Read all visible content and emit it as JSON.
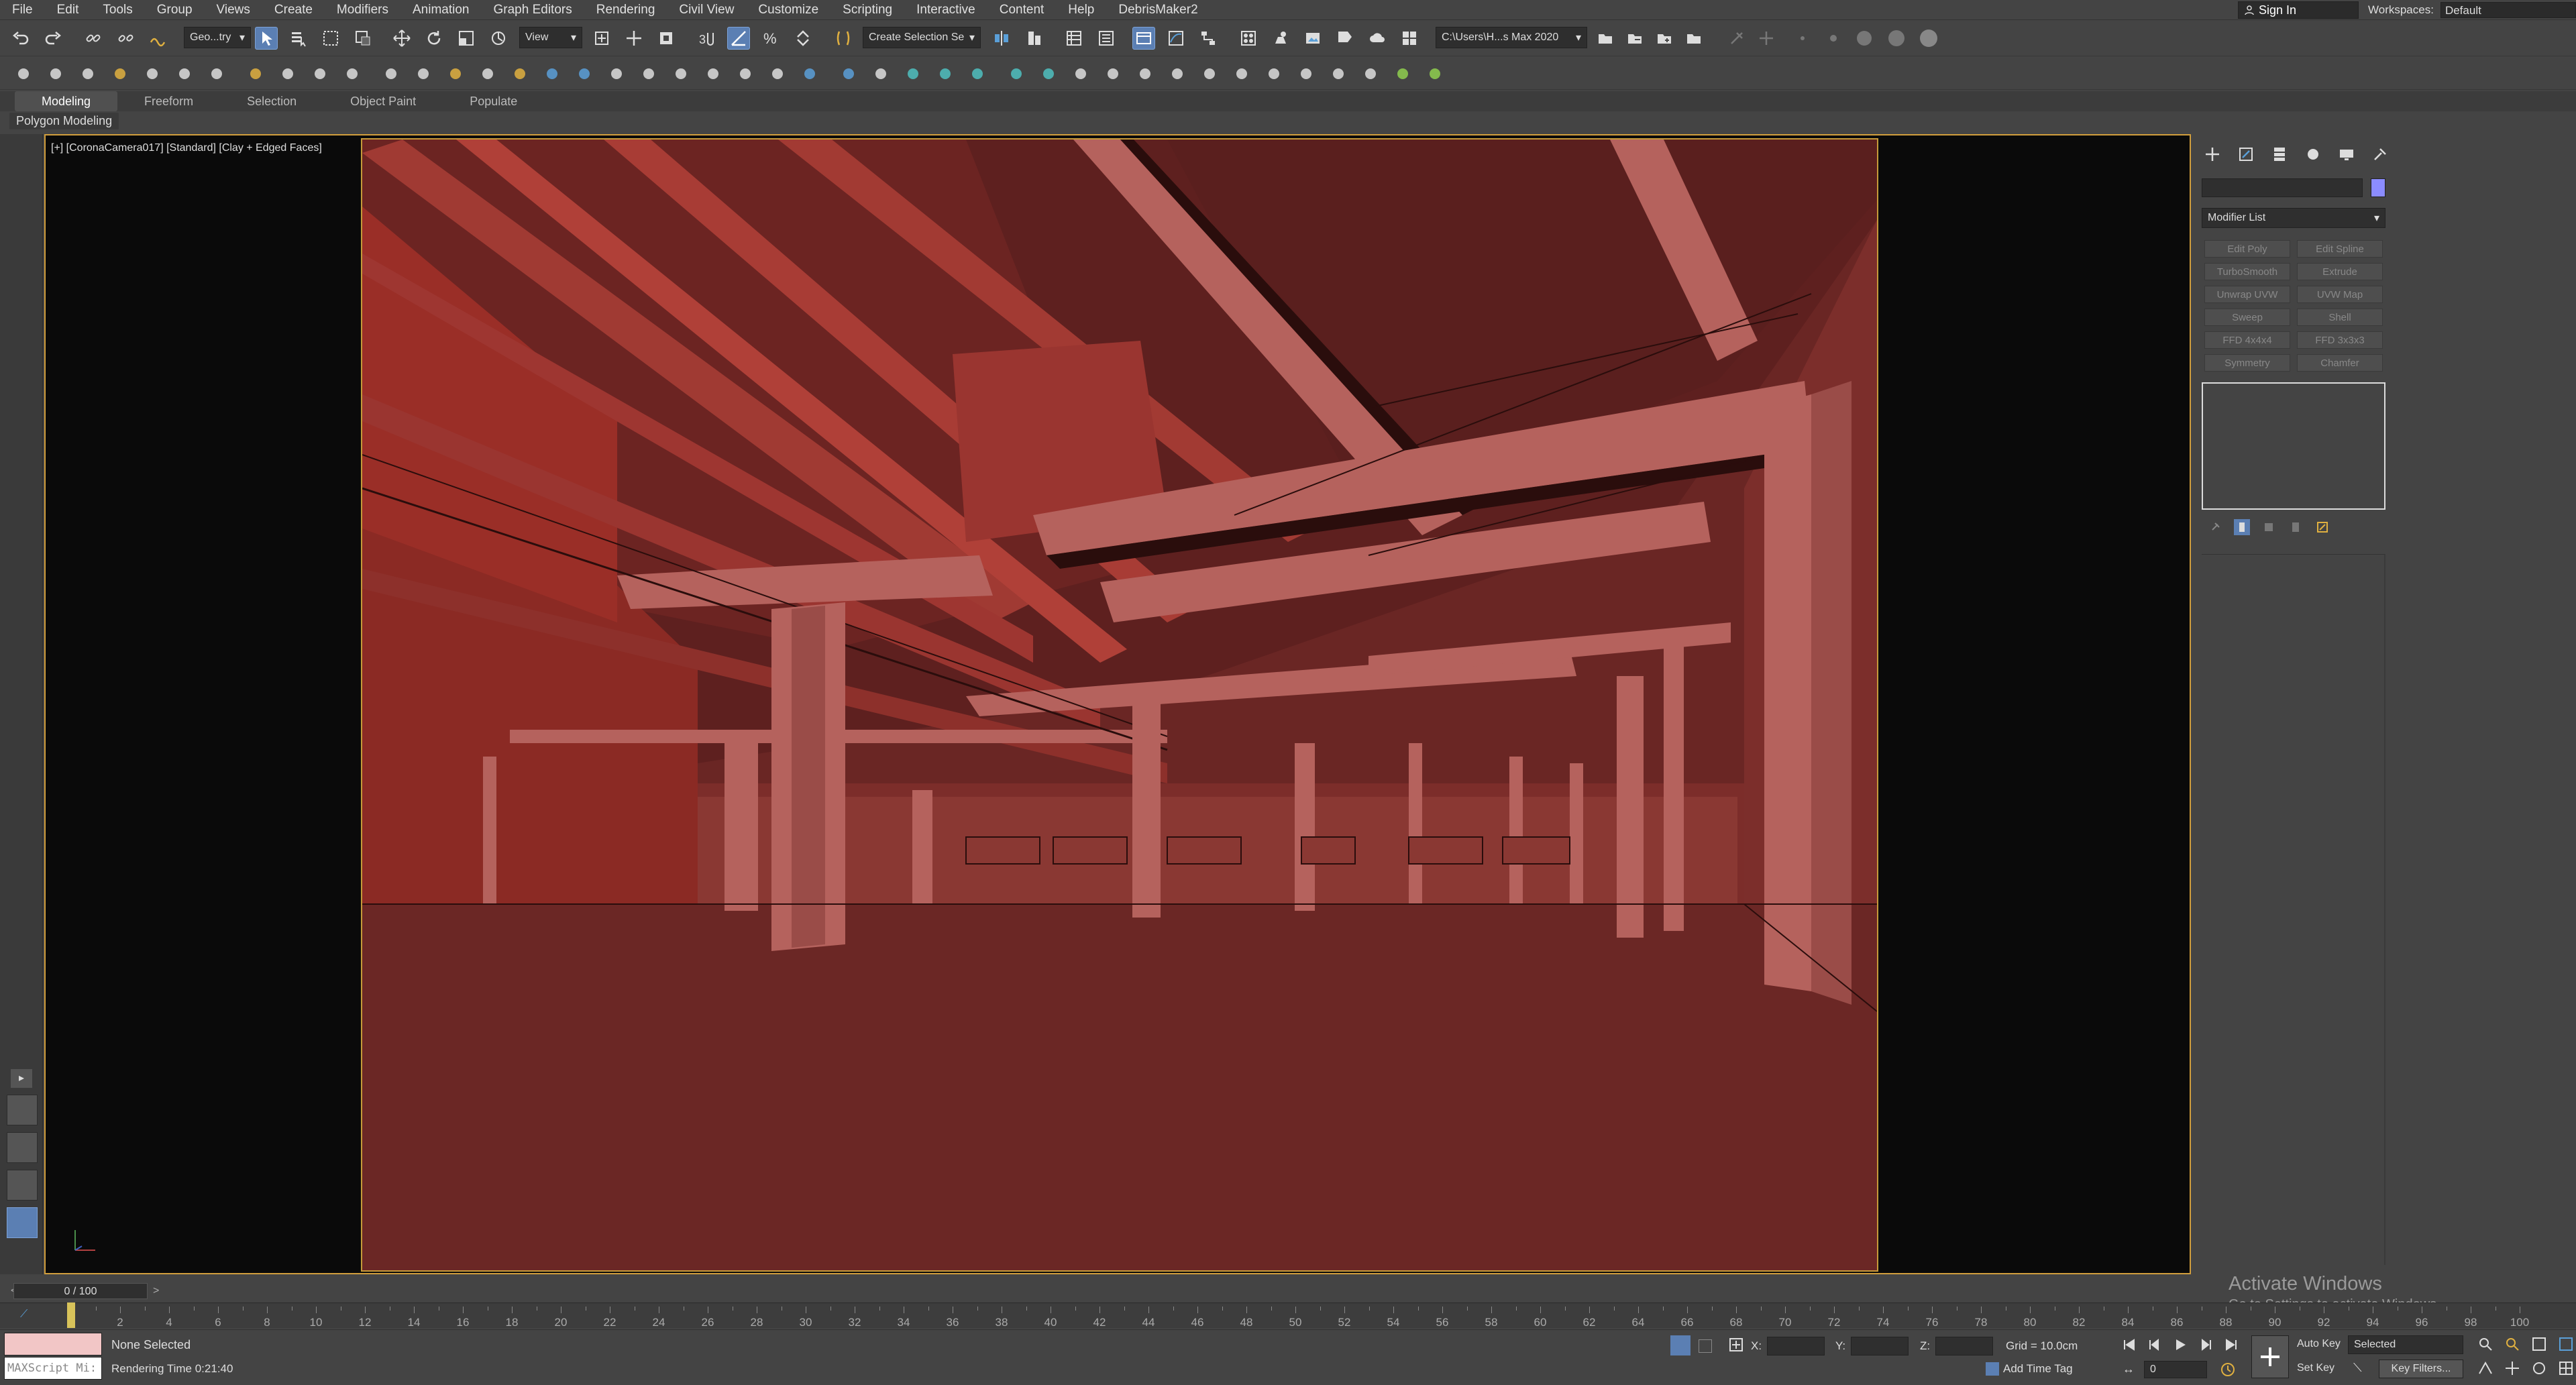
{
  "menubar": {
    "items": [
      "File",
      "Edit",
      "Tools",
      "Group",
      "Views",
      "Create",
      "Modifiers",
      "Animation",
      "Graph Editors",
      "Rendering",
      "Civil View",
      "Customize",
      "Scripting",
      "Interactive",
      "Content",
      "Help",
      "DebrisMaker2"
    ],
    "signin": "Sign In",
    "workspace_label": "Workspaces:",
    "workspace_value": "Default"
  },
  "toolbar": {
    "selection_filter": "Geo...try",
    "ref_coord": "View",
    "named_selection": "Create Selection Se",
    "project_path": "C:\\Users\\H...s Max 2020"
  },
  "ribbon": {
    "tabs": [
      "Modeling",
      "Freeform",
      "Selection",
      "Object Paint",
      "Populate"
    ],
    "active": "Modeling",
    "panel_label": "Polygon Modeling"
  },
  "viewport": {
    "label": "[+] [CoronaCamera017] [Standard] [Clay + Edged Faces]",
    "colors": {
      "scene_bg": "#6a2624",
      "beam": "#b5625d",
      "dark_edge": "#2a0d0c",
      "floor": "#6b2725"
    }
  },
  "command_panel": {
    "modifier_list": "Modifier List",
    "modifiers": [
      "Edit Poly",
      "Edit Spline",
      "TurboSmooth",
      "Extrude",
      "Unwrap UVW",
      "UVW Map",
      "Sweep",
      "Shell",
      "FFD 4x4x4",
      "FFD 3x3x3",
      "Symmetry",
      "Chamfer"
    ]
  },
  "timeline": {
    "frame_display": "0 / 100",
    "ticks": [
      2,
      4,
      6,
      8,
      10,
      12,
      14,
      16,
      18,
      20,
      22,
      24,
      26,
      28,
      30,
      32,
      34,
      36,
      38,
      40,
      42,
      44,
      46,
      48,
      50,
      52,
      54,
      56,
      58,
      60,
      62,
      64,
      66,
      68,
      70,
      72,
      74,
      76,
      78,
      80,
      82,
      84,
      86,
      88,
      90,
      92,
      94,
      96,
      98,
      100
    ],
    "current_frame": 0
  },
  "watermark": {
    "line1": "Activate Windows",
    "line2": "Go to Settings to activate Windows."
  },
  "status": {
    "maxscript_label": "MAXScript Mi:",
    "selection": "None Selected",
    "render_time": "Rendering Time  0:21:40",
    "x_label": "X:",
    "y_label": "Y:",
    "z_label": "Z:",
    "grid": "Grid = 10.0cm",
    "add_time_tag": "Add Time Tag",
    "auto_key": "Auto Key",
    "set_key": "Set Key",
    "key_mode": "Selected",
    "key_filters": "Key Filters...",
    "frame_input": "0"
  }
}
